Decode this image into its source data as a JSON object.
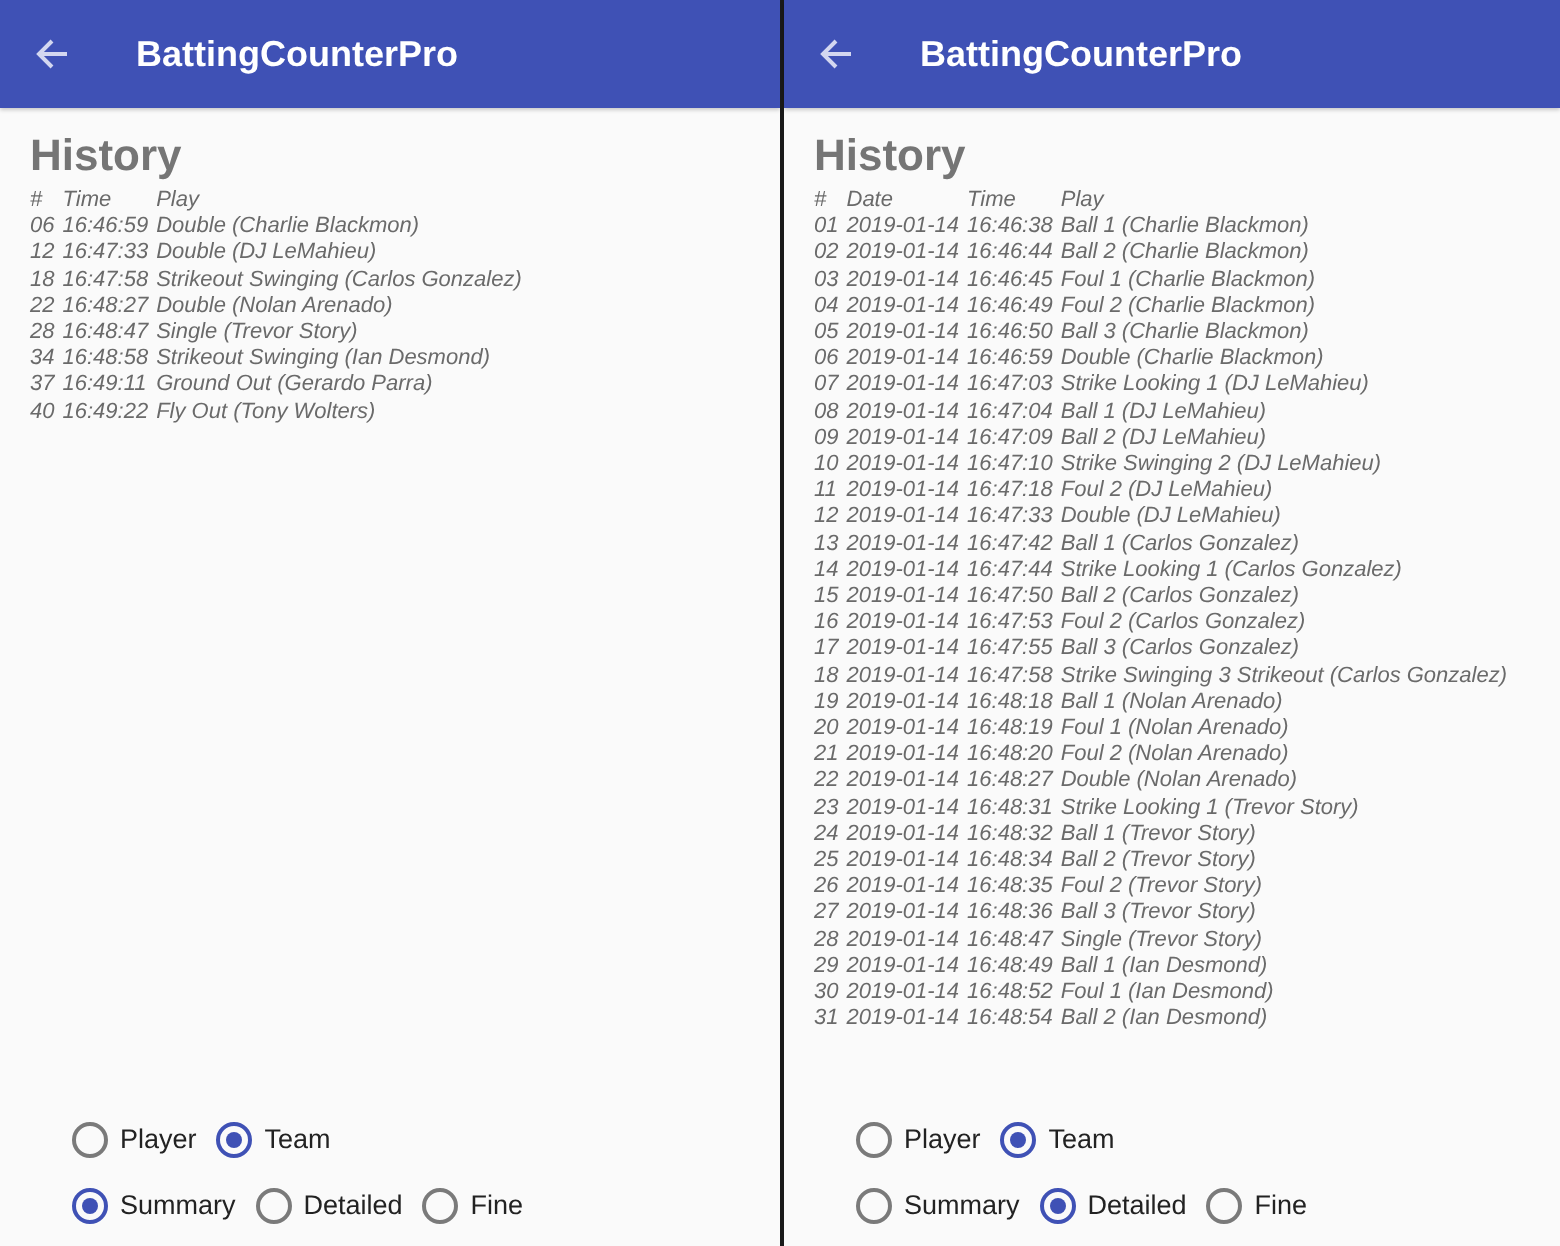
{
  "screens": [
    {
      "app_bar": {
        "title": "BattingCounterPro"
      },
      "heading": "History",
      "table": {
        "columns": [
          "#",
          "Time",
          "Play"
        ],
        "rows": [
          [
            "06",
            "16:46:59",
            "Double (Charlie Blackmon)"
          ],
          [
            "12",
            "16:47:33",
            "Double (DJ LeMahieu)"
          ],
          [
            "18",
            "16:47:58",
            "Strikeout Swinging (Carlos Gonzalez)"
          ],
          [
            "22",
            "16:48:27",
            "Double (Nolan Arenado)"
          ],
          [
            "28",
            "16:48:47",
            "Single (Trevor Story)"
          ],
          [
            "34",
            "16:48:58",
            "Strikeout Swinging (Ian Desmond)"
          ],
          [
            "37",
            "16:49:11",
            "Ground Out (Gerardo Parra)"
          ],
          [
            "40",
            "16:49:22",
            "Fly Out (Tony Wolters)"
          ]
        ]
      },
      "radio_groups": [
        {
          "options": [
            {
              "label": "Player",
              "selected": false
            },
            {
              "label": "Team",
              "selected": true
            }
          ]
        },
        {
          "options": [
            {
              "label": "Summary",
              "selected": true
            },
            {
              "label": "Detailed",
              "selected": false
            },
            {
              "label": "Fine",
              "selected": false
            }
          ]
        }
      ]
    },
    {
      "app_bar": {
        "title": "BattingCounterPro"
      },
      "heading": "History",
      "table": {
        "columns": [
          "#",
          "Date",
          "Time",
          "Play"
        ],
        "rows": [
          [
            "01",
            "2019-01-14",
            "16:46:38",
            "Ball 1 (Charlie Blackmon)"
          ],
          [
            "02",
            "2019-01-14",
            "16:46:44",
            "Ball 2 (Charlie Blackmon)"
          ],
          [
            "03",
            "2019-01-14",
            "16:46:45",
            "Foul 1 (Charlie Blackmon)"
          ],
          [
            "04",
            "2019-01-14",
            "16:46:49",
            "Foul 2 (Charlie Blackmon)"
          ],
          [
            "05",
            "2019-01-14",
            "16:46:50",
            "Ball 3 (Charlie Blackmon)"
          ],
          [
            "06",
            "2019-01-14",
            "16:46:59",
            "Double (Charlie Blackmon)"
          ],
          [
            "07",
            "2019-01-14",
            "16:47:03",
            "Strike Looking 1 (DJ LeMahieu)"
          ],
          [
            "08",
            "2019-01-14",
            "16:47:04",
            "Ball 1 (DJ LeMahieu)"
          ],
          [
            "09",
            "2019-01-14",
            "16:47:09",
            "Ball 2 (DJ LeMahieu)"
          ],
          [
            "10",
            "2019-01-14",
            "16:47:10",
            "Strike Swinging 2 (DJ LeMahieu)"
          ],
          [
            "11",
            "2019-01-14",
            "16:47:18",
            "Foul 2 (DJ LeMahieu)"
          ],
          [
            "12",
            "2019-01-14",
            "16:47:33",
            "Double (DJ LeMahieu)"
          ],
          [
            "13",
            "2019-01-14",
            "16:47:42",
            "Ball 1 (Carlos Gonzalez)"
          ],
          [
            "14",
            "2019-01-14",
            "16:47:44",
            "Strike Looking 1 (Carlos Gonzalez)"
          ],
          [
            "15",
            "2019-01-14",
            "16:47:50",
            "Ball 2 (Carlos Gonzalez)"
          ],
          [
            "16",
            "2019-01-14",
            "16:47:53",
            "Foul 2 (Carlos Gonzalez)"
          ],
          [
            "17",
            "2019-01-14",
            "16:47:55",
            "Ball 3 (Carlos Gonzalez)"
          ],
          [
            "18",
            "2019-01-14",
            "16:47:58",
            "Strike Swinging 3 Strikeout (Carlos Gonzalez)"
          ],
          [
            "19",
            "2019-01-14",
            "16:48:18",
            "Ball 1 (Nolan Arenado)"
          ],
          [
            "20",
            "2019-01-14",
            "16:48:19",
            "Foul 1 (Nolan Arenado)"
          ],
          [
            "21",
            "2019-01-14",
            "16:48:20",
            "Foul 2 (Nolan Arenado)"
          ],
          [
            "22",
            "2019-01-14",
            "16:48:27",
            "Double (Nolan Arenado)"
          ],
          [
            "23",
            "2019-01-14",
            "16:48:31",
            "Strike Looking 1 (Trevor Story)"
          ],
          [
            "24",
            "2019-01-14",
            "16:48:32",
            "Ball 1 (Trevor Story)"
          ],
          [
            "25",
            "2019-01-14",
            "16:48:34",
            "Ball 2 (Trevor Story)"
          ],
          [
            "26",
            "2019-01-14",
            "16:48:35",
            "Foul 2 (Trevor Story)"
          ],
          [
            "27",
            "2019-01-14",
            "16:48:36",
            "Ball 3 (Trevor Story)"
          ],
          [
            "28",
            "2019-01-14",
            "16:48:47",
            "Single (Trevor Story)"
          ],
          [
            "29",
            "2019-01-14",
            "16:48:49",
            "Ball 1 (Ian Desmond)"
          ],
          [
            "30",
            "2019-01-14",
            "16:48:52",
            "Foul 1 (Ian Desmond)"
          ],
          [
            "31",
            "2019-01-14",
            "16:48:54",
            "Ball 2 (Ian Desmond)"
          ]
        ]
      },
      "radio_groups": [
        {
          "options": [
            {
              "label": "Player",
              "selected": false
            },
            {
              "label": "Team",
              "selected": true
            }
          ]
        },
        {
          "options": [
            {
              "label": "Summary",
              "selected": false
            },
            {
              "label": "Detailed",
              "selected": true
            },
            {
              "label": "Fine",
              "selected": false
            }
          ]
        }
      ]
    }
  ]
}
